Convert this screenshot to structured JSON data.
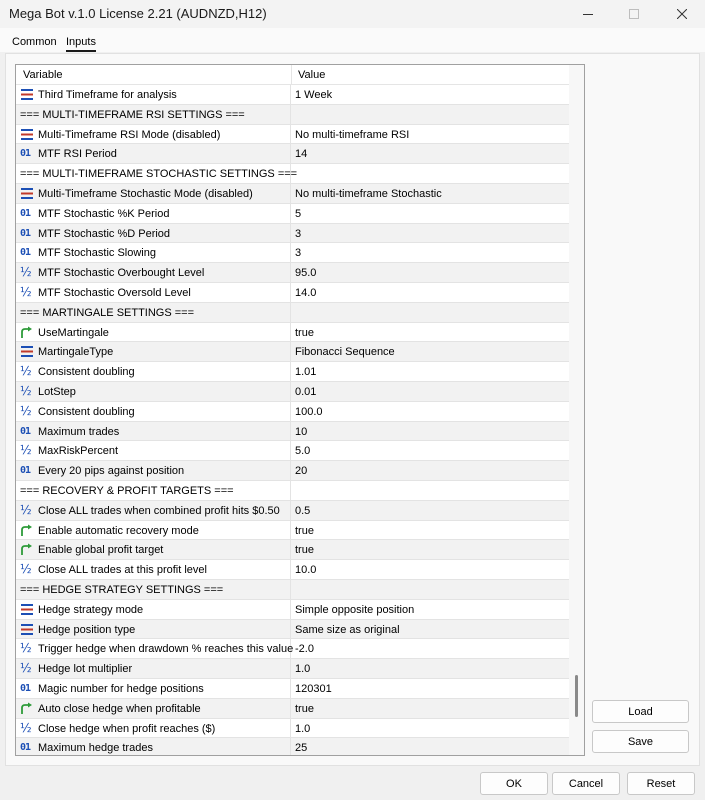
{
  "window": {
    "title": "Mega Bot v.1.0 License 2.21 (AUDNZD,H12)",
    "close_icon": "close-icon",
    "minimize_icon": "minimize-icon",
    "maximize_icon": "maximize-icon"
  },
  "tabs": [
    {
      "label": "Common",
      "active": false
    },
    {
      "label": "Inputs",
      "active": true
    }
  ],
  "table": {
    "headers": {
      "variable": "Variable",
      "value": "Value"
    },
    "rows": [
      {
        "icon": "enum",
        "variable": "Third Timeframe for analysis",
        "value": "1 Week"
      },
      {
        "icon": "section",
        "variable": "=== MULTI-TIMEFRAME RSI SETTINGS ===",
        "value": ""
      },
      {
        "icon": "enum",
        "variable": "Multi-Timeframe RSI Mode (disabled)",
        "value": "No multi-timeframe RSI"
      },
      {
        "icon": "int",
        "variable": "MTF RSI Period",
        "value": "14"
      },
      {
        "icon": "section",
        "variable": "=== MULTI-TIMEFRAME STOCHASTIC SETTINGS ===",
        "value": ""
      },
      {
        "icon": "enum",
        "variable": "Multi-Timeframe Stochastic Mode (disabled)",
        "value": "No multi-timeframe Stochastic"
      },
      {
        "icon": "int",
        "variable": "MTF Stochastic %K Period",
        "value": "5"
      },
      {
        "icon": "int",
        "variable": "MTF Stochastic %D Period",
        "value": "3"
      },
      {
        "icon": "int",
        "variable": "MTF Stochastic Slowing",
        "value": "3"
      },
      {
        "icon": "double",
        "variable": "MTF Stochastic Overbought Level",
        "value": "95.0"
      },
      {
        "icon": "double",
        "variable": "MTF Stochastic Oversold Level",
        "value": "14.0"
      },
      {
        "icon": "section",
        "variable": "=== MARTINGALE SETTINGS ===",
        "value": ""
      },
      {
        "icon": "bool",
        "variable": "UseMartingale",
        "value": "true"
      },
      {
        "icon": "enum",
        "variable": "MartingaleType",
        "value": "Fibonacci Sequence"
      },
      {
        "icon": "double",
        "variable": "Consistent doubling",
        "value": "1.01"
      },
      {
        "icon": "double",
        "variable": "LotStep",
        "value": "0.01"
      },
      {
        "icon": "double",
        "variable": "Consistent doubling",
        "value": "100.0"
      },
      {
        "icon": "int",
        "variable": "Maximum trades",
        "value": "10"
      },
      {
        "icon": "double",
        "variable": "MaxRiskPercent",
        "value": "5.0"
      },
      {
        "icon": "int",
        "variable": "Every 20 pips against position",
        "value": "20"
      },
      {
        "icon": "section",
        "variable": "=== RECOVERY & PROFIT TARGETS ===",
        "value": ""
      },
      {
        "icon": "double",
        "variable": "Close ALL trades when combined profit hits $0.50",
        "value": "0.5"
      },
      {
        "icon": "bool",
        "variable": "Enable automatic recovery mode",
        "value": "true"
      },
      {
        "icon": "bool",
        "variable": "Enable global profit target",
        "value": "true"
      },
      {
        "icon": "double",
        "variable": "Close ALL trades at this profit level",
        "value": "10.0"
      },
      {
        "icon": "section",
        "variable": "=== HEDGE STRATEGY SETTINGS ===",
        "value": ""
      },
      {
        "icon": "enum",
        "variable": "Hedge strategy mode",
        "value": "Simple opposite position"
      },
      {
        "icon": "enum",
        "variable": "Hedge position type",
        "value": "Same size as original"
      },
      {
        "icon": "double",
        "variable": "Trigger hedge when drawdown % reaches this value",
        "value": "-2.0"
      },
      {
        "icon": "double",
        "variable": "Hedge lot multiplier",
        "value": "1.0"
      },
      {
        "icon": "int",
        "variable": "Magic number for hedge positions",
        "value": "120301"
      },
      {
        "icon": "bool",
        "variable": "Auto close hedge when profitable",
        "value": "true"
      },
      {
        "icon": "double",
        "variable": "Close hedge when profit reaches ($)",
        "value": "1.0"
      },
      {
        "icon": "int",
        "variable": "Maximum hedge trades",
        "value": "25"
      }
    ]
  },
  "side_buttons": {
    "load": "Load",
    "save": "Save"
  },
  "bottom_buttons": {
    "ok": "OK",
    "cancel": "Cancel",
    "reset": "Reset"
  },
  "colors": {
    "icon_blue": "#1c4fb5",
    "bool_green": "#2e9b3a",
    "enum_red": "#c0392b"
  }
}
